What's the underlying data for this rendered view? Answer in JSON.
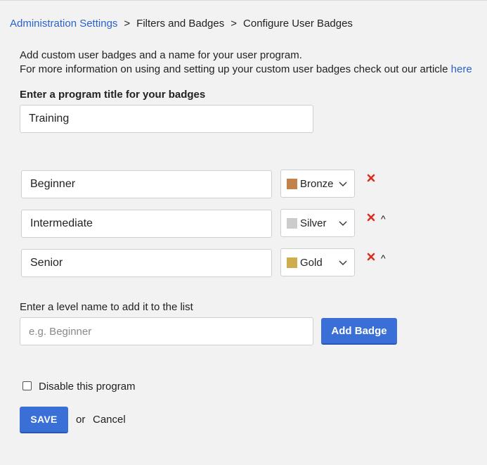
{
  "breadcrumb": {
    "items": [
      "Administration Settings",
      "Filters and Badges",
      "Configure User Badges"
    ],
    "separator": ">"
  },
  "intro": {
    "line1": "Add custom user badges and a name for your user program.",
    "line2": "For more information on using and setting up your custom user badges check out our article ",
    "link_label": "here"
  },
  "program": {
    "title_label": "Enter a program title for your badges",
    "title_value": "Training"
  },
  "badges": [
    {
      "name": "Beginner",
      "level": "Bronze",
      "color": "#c2824a",
      "has_move_up": false
    },
    {
      "name": "Intermediate",
      "level": "Silver",
      "color": "#cccccc",
      "has_move_up": true
    },
    {
      "name": "Senior",
      "level": "Gold",
      "color": "#cfac4c",
      "has_move_up": true
    }
  ],
  "icons": {
    "remove": "close-icon",
    "move_up": "caret-up-icon",
    "move_up_glyph": "^",
    "dropdown": "chevron-down-icon",
    "remove_color": "#d93025"
  },
  "add_level": {
    "label": "Enter a level name to add it to the list",
    "placeholder": "e.g. Beginner",
    "button_label": "Add Badge"
  },
  "disable": {
    "label": "Disable this program",
    "checked": false
  },
  "actions": {
    "save_label": "SAVE",
    "or_label": "or",
    "cancel_label": "Cancel"
  },
  "colors": {
    "accent": "#3b6fd8",
    "link": "#2a62c9",
    "background": "#f2f2f2"
  }
}
